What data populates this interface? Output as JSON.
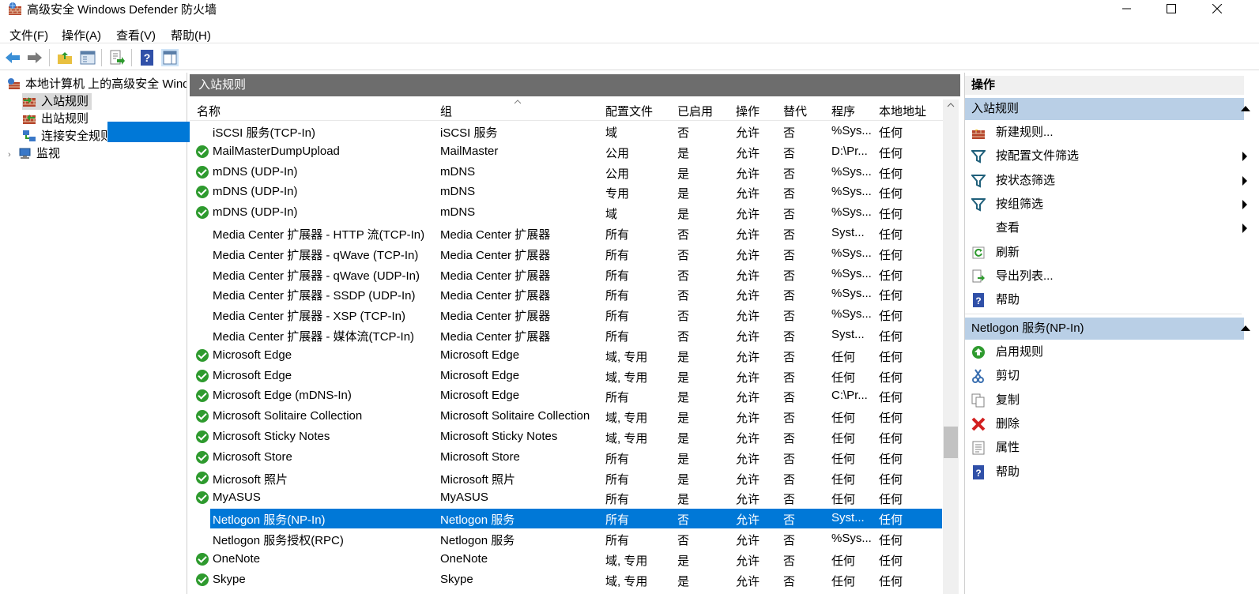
{
  "window": {
    "title": "高级安全 Windows Defender 防火墙",
    "minimize": "—",
    "maximize": "☐",
    "close": "✕"
  },
  "menu": [
    "文件(F)",
    "操作(A)",
    "查看(V)",
    "帮助(H)"
  ],
  "tree": {
    "root": "本地计算机 上的高级安全 Windows Defender 防火墙",
    "items": [
      "入站规则",
      "出站规则",
      "连接安全规则",
      "监视"
    ]
  },
  "center": {
    "title": "入站规则",
    "columns": [
      "名称",
      "组",
      "配置文件",
      "已启用",
      "操作",
      "替代",
      "程序",
      "本地地址"
    ],
    "rows": [
      {
        "enabled_icon": false,
        "name": "iSCSI 服务(TCP-In)",
        "group": "iSCSI 服务",
        "profile": "域",
        "enabled": "否",
        "action": "允许",
        "override": "否",
        "program": "%Sys...",
        "local": "任何"
      },
      {
        "enabled_icon": true,
        "name": "MailMasterDumpUpload",
        "group": "MailMaster",
        "profile": "公用",
        "enabled": "是",
        "action": "允许",
        "override": "否",
        "program": "D:\\Pr...",
        "local": "任何"
      },
      {
        "enabled_icon": true,
        "name": "mDNS (UDP-In)",
        "group": "mDNS",
        "profile": "公用",
        "enabled": "是",
        "action": "允许",
        "override": "否",
        "program": "%Sys...",
        "local": "任何"
      },
      {
        "enabled_icon": true,
        "name": "mDNS (UDP-In)",
        "group": "mDNS",
        "profile": "专用",
        "enabled": "是",
        "action": "允许",
        "override": "否",
        "program": "%Sys...",
        "local": "任何"
      },
      {
        "enabled_icon": true,
        "name": "mDNS (UDP-In)",
        "group": "mDNS",
        "profile": "域",
        "enabled": "是",
        "action": "允许",
        "override": "否",
        "program": "%Sys...",
        "local": "任何"
      },
      {
        "enabled_icon": false,
        "name": "Media Center 扩展器 - HTTP 流(TCP-In)",
        "group": "Media Center 扩展器",
        "profile": "所有",
        "enabled": "否",
        "action": "允许",
        "override": "否",
        "program": "Syst...",
        "local": "任何"
      },
      {
        "enabled_icon": false,
        "name": "Media Center 扩展器 - qWave (TCP-In)",
        "group": "Media Center 扩展器",
        "profile": "所有",
        "enabled": "否",
        "action": "允许",
        "override": "否",
        "program": "%Sys...",
        "local": "任何"
      },
      {
        "enabled_icon": false,
        "name": "Media Center 扩展器 - qWave (UDP-In)",
        "group": "Media Center 扩展器",
        "profile": "所有",
        "enabled": "否",
        "action": "允许",
        "override": "否",
        "program": "%Sys...",
        "local": "任何"
      },
      {
        "enabled_icon": false,
        "name": "Media Center 扩展器 - SSDP (UDP-In)",
        "group": "Media Center 扩展器",
        "profile": "所有",
        "enabled": "否",
        "action": "允许",
        "override": "否",
        "program": "%Sys...",
        "local": "任何"
      },
      {
        "enabled_icon": false,
        "name": "Media Center 扩展器 - XSP (TCP-In)",
        "group": "Media Center 扩展器",
        "profile": "所有",
        "enabled": "否",
        "action": "允许",
        "override": "否",
        "program": "%Sys...",
        "local": "任何"
      },
      {
        "enabled_icon": false,
        "name": "Media Center 扩展器 - 媒体流(TCP-In)",
        "group": "Media Center 扩展器",
        "profile": "所有",
        "enabled": "否",
        "action": "允许",
        "override": "否",
        "program": "Syst...",
        "local": "任何"
      },
      {
        "enabled_icon": true,
        "name": "Microsoft Edge",
        "group": "Microsoft Edge",
        "profile": "域, 专用",
        "enabled": "是",
        "action": "允许",
        "override": "否",
        "program": "任何",
        "local": "任何"
      },
      {
        "enabled_icon": true,
        "name": "Microsoft Edge",
        "group": "Microsoft Edge",
        "profile": "域, 专用",
        "enabled": "是",
        "action": "允许",
        "override": "否",
        "program": "任何",
        "local": "任何"
      },
      {
        "enabled_icon": true,
        "name": "Microsoft Edge (mDNS-In)",
        "group": "Microsoft Edge",
        "profile": "所有",
        "enabled": "是",
        "action": "允许",
        "override": "否",
        "program": "C:\\Pr...",
        "local": "任何"
      },
      {
        "enabled_icon": true,
        "name": "Microsoft Solitaire Collection",
        "group": "Microsoft Solitaire Collection",
        "profile": "域, 专用",
        "enabled": "是",
        "action": "允许",
        "override": "否",
        "program": "任何",
        "local": "任何"
      },
      {
        "enabled_icon": true,
        "name": "Microsoft Sticky Notes",
        "group": "Microsoft Sticky Notes",
        "profile": "域, 专用",
        "enabled": "是",
        "action": "允许",
        "override": "否",
        "program": "任何",
        "local": "任何"
      },
      {
        "enabled_icon": true,
        "name": "Microsoft Store",
        "group": "Microsoft Store",
        "profile": "所有",
        "enabled": "是",
        "action": "允许",
        "override": "否",
        "program": "任何",
        "local": "任何"
      },
      {
        "enabled_icon": true,
        "name": "Microsoft 照片",
        "group": "Microsoft 照片",
        "profile": "所有",
        "enabled": "是",
        "action": "允许",
        "override": "否",
        "program": "任何",
        "local": "任何"
      },
      {
        "enabled_icon": true,
        "name": "MyASUS",
        "group": "MyASUS",
        "profile": "所有",
        "enabled": "是",
        "action": "允许",
        "override": "否",
        "program": "任何",
        "local": "任何"
      },
      {
        "enabled_icon": false,
        "selected": true,
        "name": "Netlogon 服务(NP-In)",
        "group": "Netlogon 服务",
        "profile": "所有",
        "enabled": "否",
        "action": "允许",
        "override": "否",
        "program": "Syst...",
        "local": "任何"
      },
      {
        "enabled_icon": false,
        "name": "Netlogon 服务授权(RPC)",
        "group": "Netlogon 服务",
        "profile": "所有",
        "enabled": "否",
        "action": "允许",
        "override": "否",
        "program": "%Sys...",
        "local": "任何"
      },
      {
        "enabled_icon": true,
        "name": "OneNote",
        "group": "OneNote",
        "profile": "域, 专用",
        "enabled": "是",
        "action": "允许",
        "override": "否",
        "program": "任何",
        "local": "任何"
      },
      {
        "enabled_icon": true,
        "name": "Skype",
        "group": "Skype",
        "profile": "域, 专用",
        "enabled": "是",
        "action": "允许",
        "override": "否",
        "program": "任何",
        "local": "任何"
      }
    ]
  },
  "actions": {
    "title": "操作",
    "section1": "入站规则",
    "section1_items": [
      {
        "label": "新建规则...",
        "icon": "new-rule-icon",
        "submenu": false
      },
      {
        "label": "按配置文件筛选",
        "icon": "filter-icon",
        "submenu": true
      },
      {
        "label": "按状态筛选",
        "icon": "filter-icon",
        "submenu": true
      },
      {
        "label": "按组筛选",
        "icon": "filter-icon",
        "submenu": true
      },
      {
        "label": "查看",
        "icon": "",
        "submenu": true
      },
      {
        "label": "刷新",
        "icon": "refresh-icon",
        "submenu": false
      },
      {
        "label": "导出列表...",
        "icon": "export-icon",
        "submenu": false
      },
      {
        "label": "帮助",
        "icon": "help-icon",
        "submenu": false
      }
    ],
    "section2": "Netlogon 服务(NP-In)",
    "section2_items": [
      {
        "label": "启用规则",
        "icon": "enable-rule-icon"
      },
      {
        "label": "剪切",
        "icon": "cut-icon"
      },
      {
        "label": "复制",
        "icon": "copy-icon"
      },
      {
        "label": "删除",
        "icon": "delete-icon"
      },
      {
        "label": "属性",
        "icon": "properties-icon"
      },
      {
        "label": "帮助",
        "icon": "help-icon"
      }
    ]
  },
  "colors": {
    "selection": "#0078d7",
    "section_header": "#b9cfe6",
    "panel_header": "#6d6d6d",
    "enabled_check": "#2e9a2e"
  }
}
